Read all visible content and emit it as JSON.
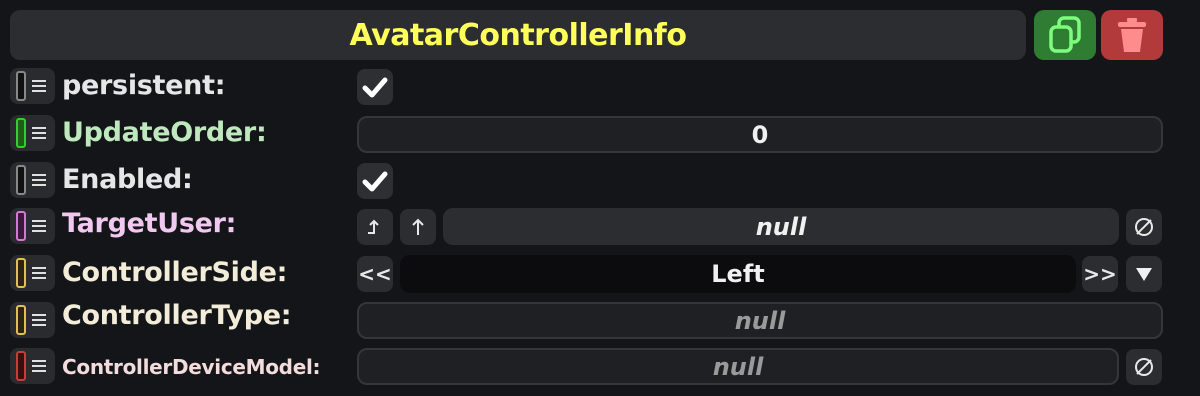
{
  "header": {
    "title": "AvatarControllerInfo",
    "duplicate_icon": "duplicate-icon",
    "delete_icon": "trash-icon",
    "duplicate_color": "#2e7d32",
    "delete_color": "#b23a3a"
  },
  "fields": [
    {
      "label": "persistent:",
      "color": "#e6e6e6",
      "swatch": "#111111",
      "type": "checkbox",
      "checked": true
    },
    {
      "label": "UpdateOrder:",
      "color": "#bfe8bf",
      "swatch": "#2fae2f",
      "type": "number",
      "value": "0"
    },
    {
      "label": "Enabled:",
      "color": "#e6e6e6",
      "swatch": "#111111",
      "type": "checkbox",
      "checked": true
    },
    {
      "label": "TargetUser:",
      "color": "#f0c8f0",
      "swatch": "#c46ac4",
      "type": "reference",
      "value": "null"
    },
    {
      "label": "ControllerSide:",
      "color": "#f2ecd8",
      "swatch": "#d1b24a",
      "type": "enum",
      "value": "Left",
      "prev": "<<",
      "next": ">>"
    },
    {
      "label": "ControllerType:",
      "color": "#f2ecd8",
      "swatch": "#d1b24a",
      "type": "readonly",
      "value": "null"
    },
    {
      "label": "ControllerDeviceModel:",
      "color": "#f2dcdc",
      "swatch": "#b83a3a",
      "type": "nullable",
      "value": "null"
    }
  ],
  "icons": {
    "check": "checkmark-icon",
    "null": "null-icon",
    "dropdown": "dropdown-arrow-icon",
    "jump": "jump-to-icon",
    "up": "up-arrow-icon"
  }
}
